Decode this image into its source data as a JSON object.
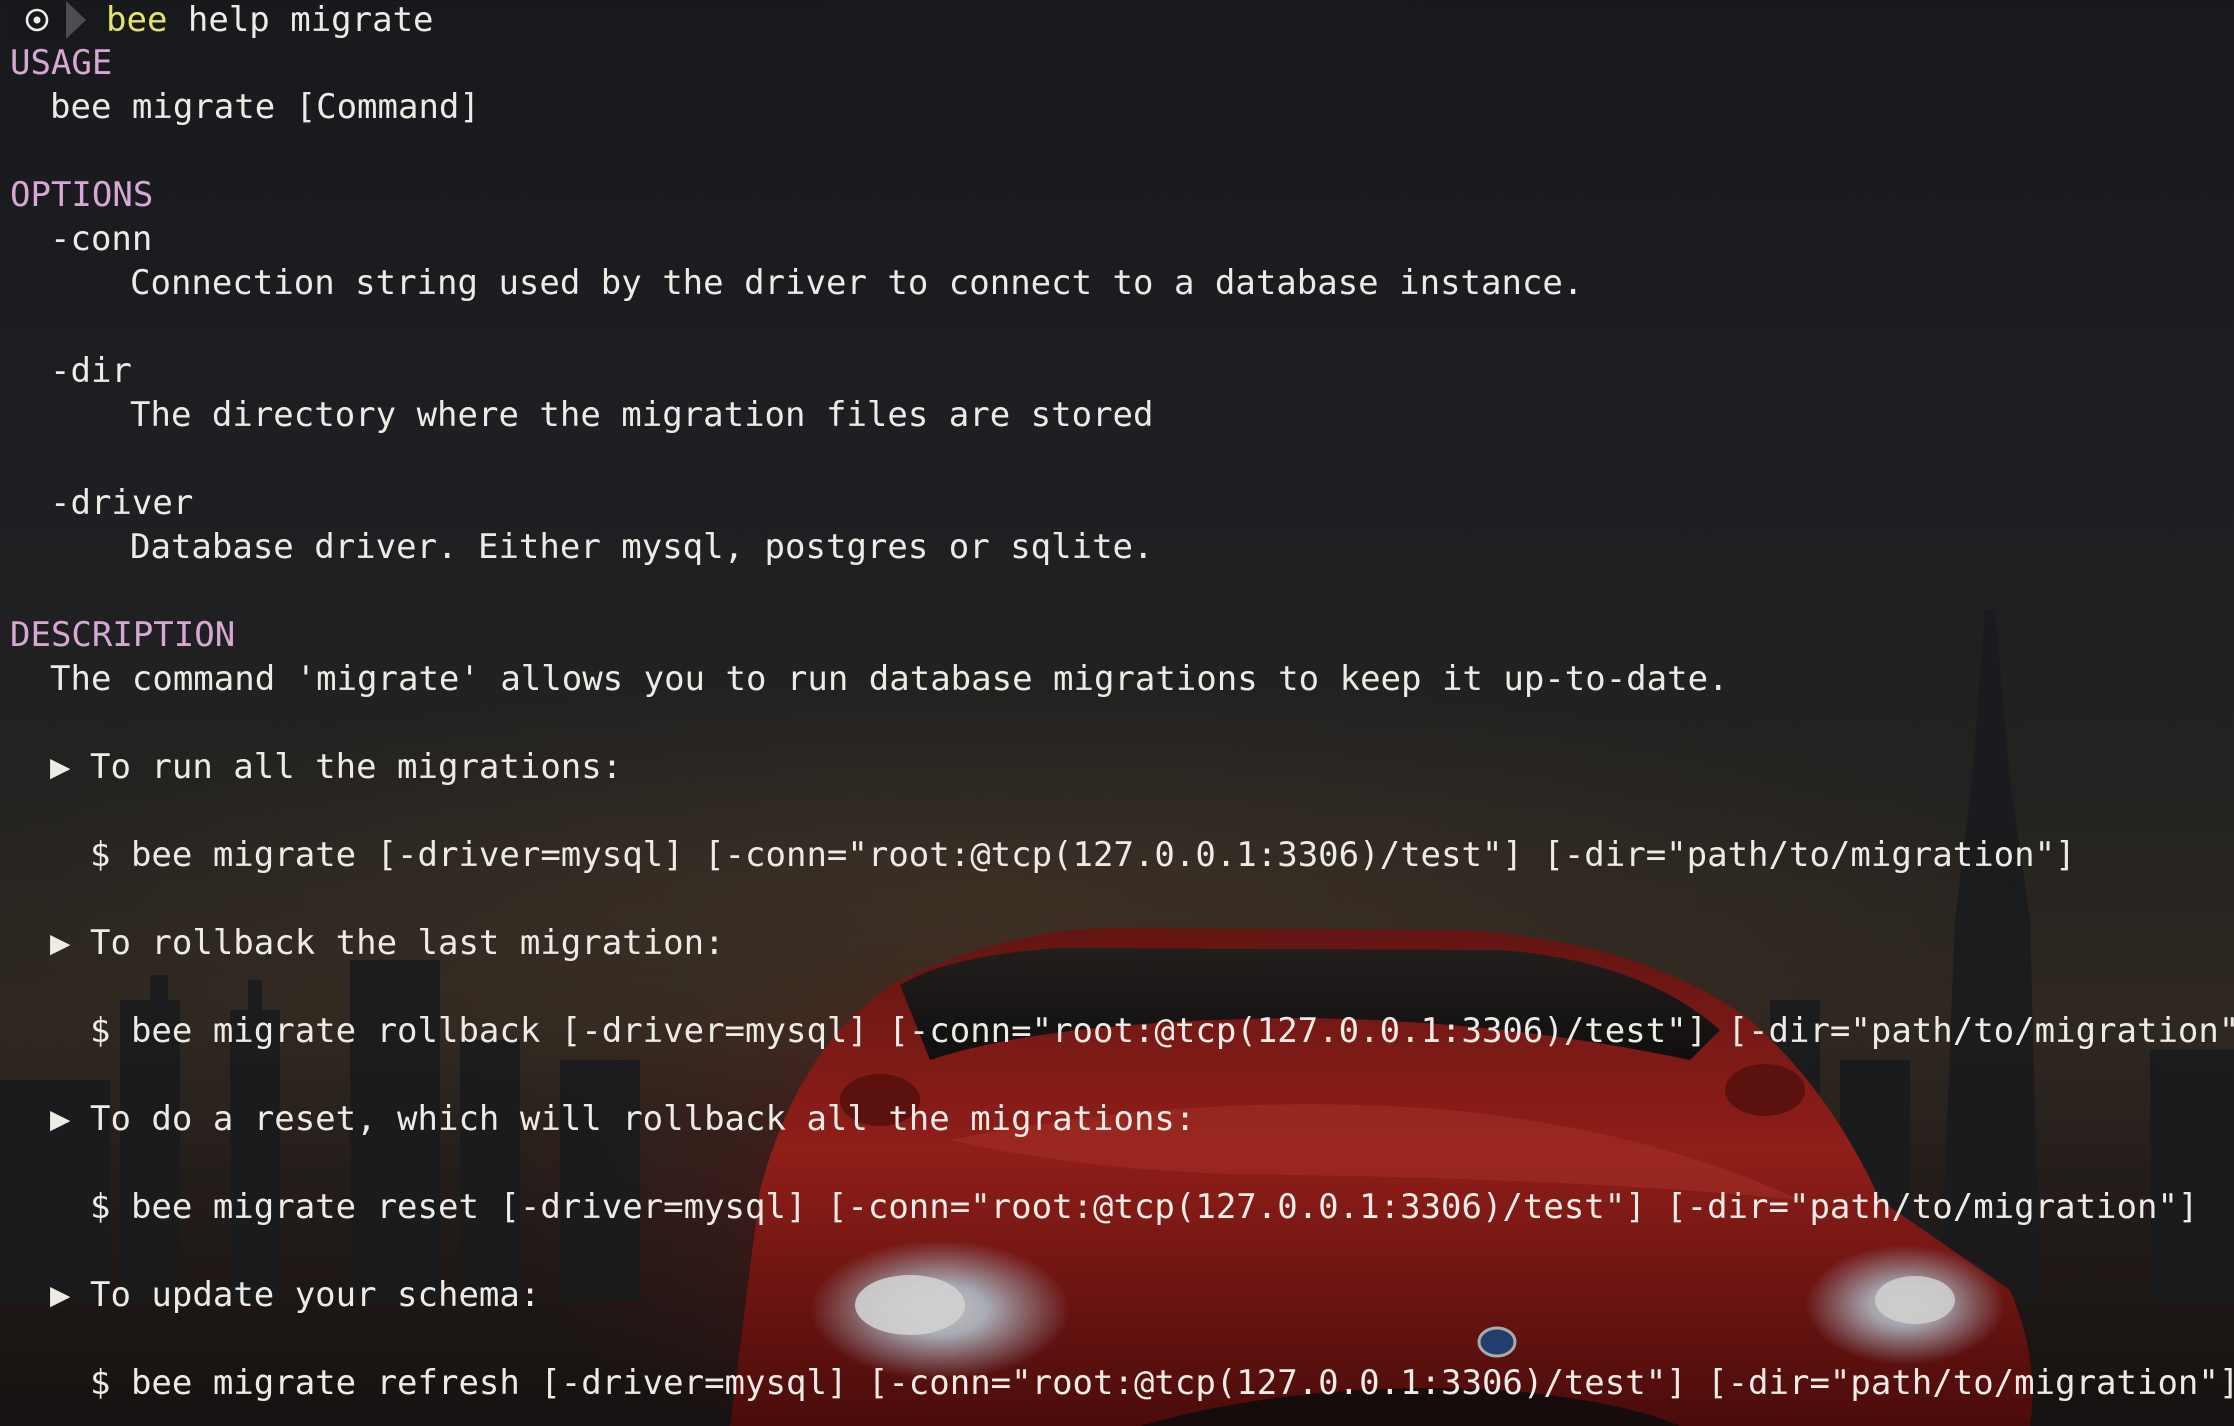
{
  "prompt": {
    "icon": "terminal-swirl-icon",
    "command_bin": "bee",
    "command_args": " help migrate"
  },
  "usage": {
    "heading": "USAGE",
    "syntax": "bee migrate [Command]"
  },
  "options": {
    "heading": "OPTIONS",
    "items": [
      {
        "flag": "-conn",
        "description": "Connection string used by the driver to connect to a database instance."
      },
      {
        "flag": "-dir",
        "description": "The directory where the migration files are stored"
      },
      {
        "flag": "-driver",
        "description": "Database driver. Either mysql, postgres or sqlite."
      }
    ]
  },
  "description": {
    "heading": "DESCRIPTION",
    "summary": "The command 'migrate' allows you to run database migrations to keep it up-to-date.",
    "bullet_glyph": "▶",
    "examples": [
      {
        "title": "To run all the migrations:",
        "command": "$ bee migrate [-driver=mysql] [-conn=\"root:@tcp(127.0.0.1:3306)/test\"] [-dir=\"path/to/migration\"]"
      },
      {
        "title": "To rollback the last migration:",
        "command": "$ bee migrate rollback [-driver=mysql] [-conn=\"root:@tcp(127.0.0.1:3306)/test\"] [-dir=\"path/to/migration\"]"
      },
      {
        "title": "To do a reset, which will rollback all the migrations:",
        "command": "$ bee migrate reset [-driver=mysql] [-conn=\"root:@tcp(127.0.0.1:3306)/test\"] [-dir=\"path/to/migration\"]"
      },
      {
        "title": "To update your schema:",
        "command": "$ bee migrate refresh [-driver=mysql] [-conn=\"root:@tcp(127.0.0.1:3306)/test\"] [-dir=\"path/to/migration\"]"
      }
    ]
  },
  "colors": {
    "foreground": "#ecebe6",
    "section_heading": "#d6a8d4",
    "command_bin": "#e6e36c",
    "background": "#25272b"
  }
}
